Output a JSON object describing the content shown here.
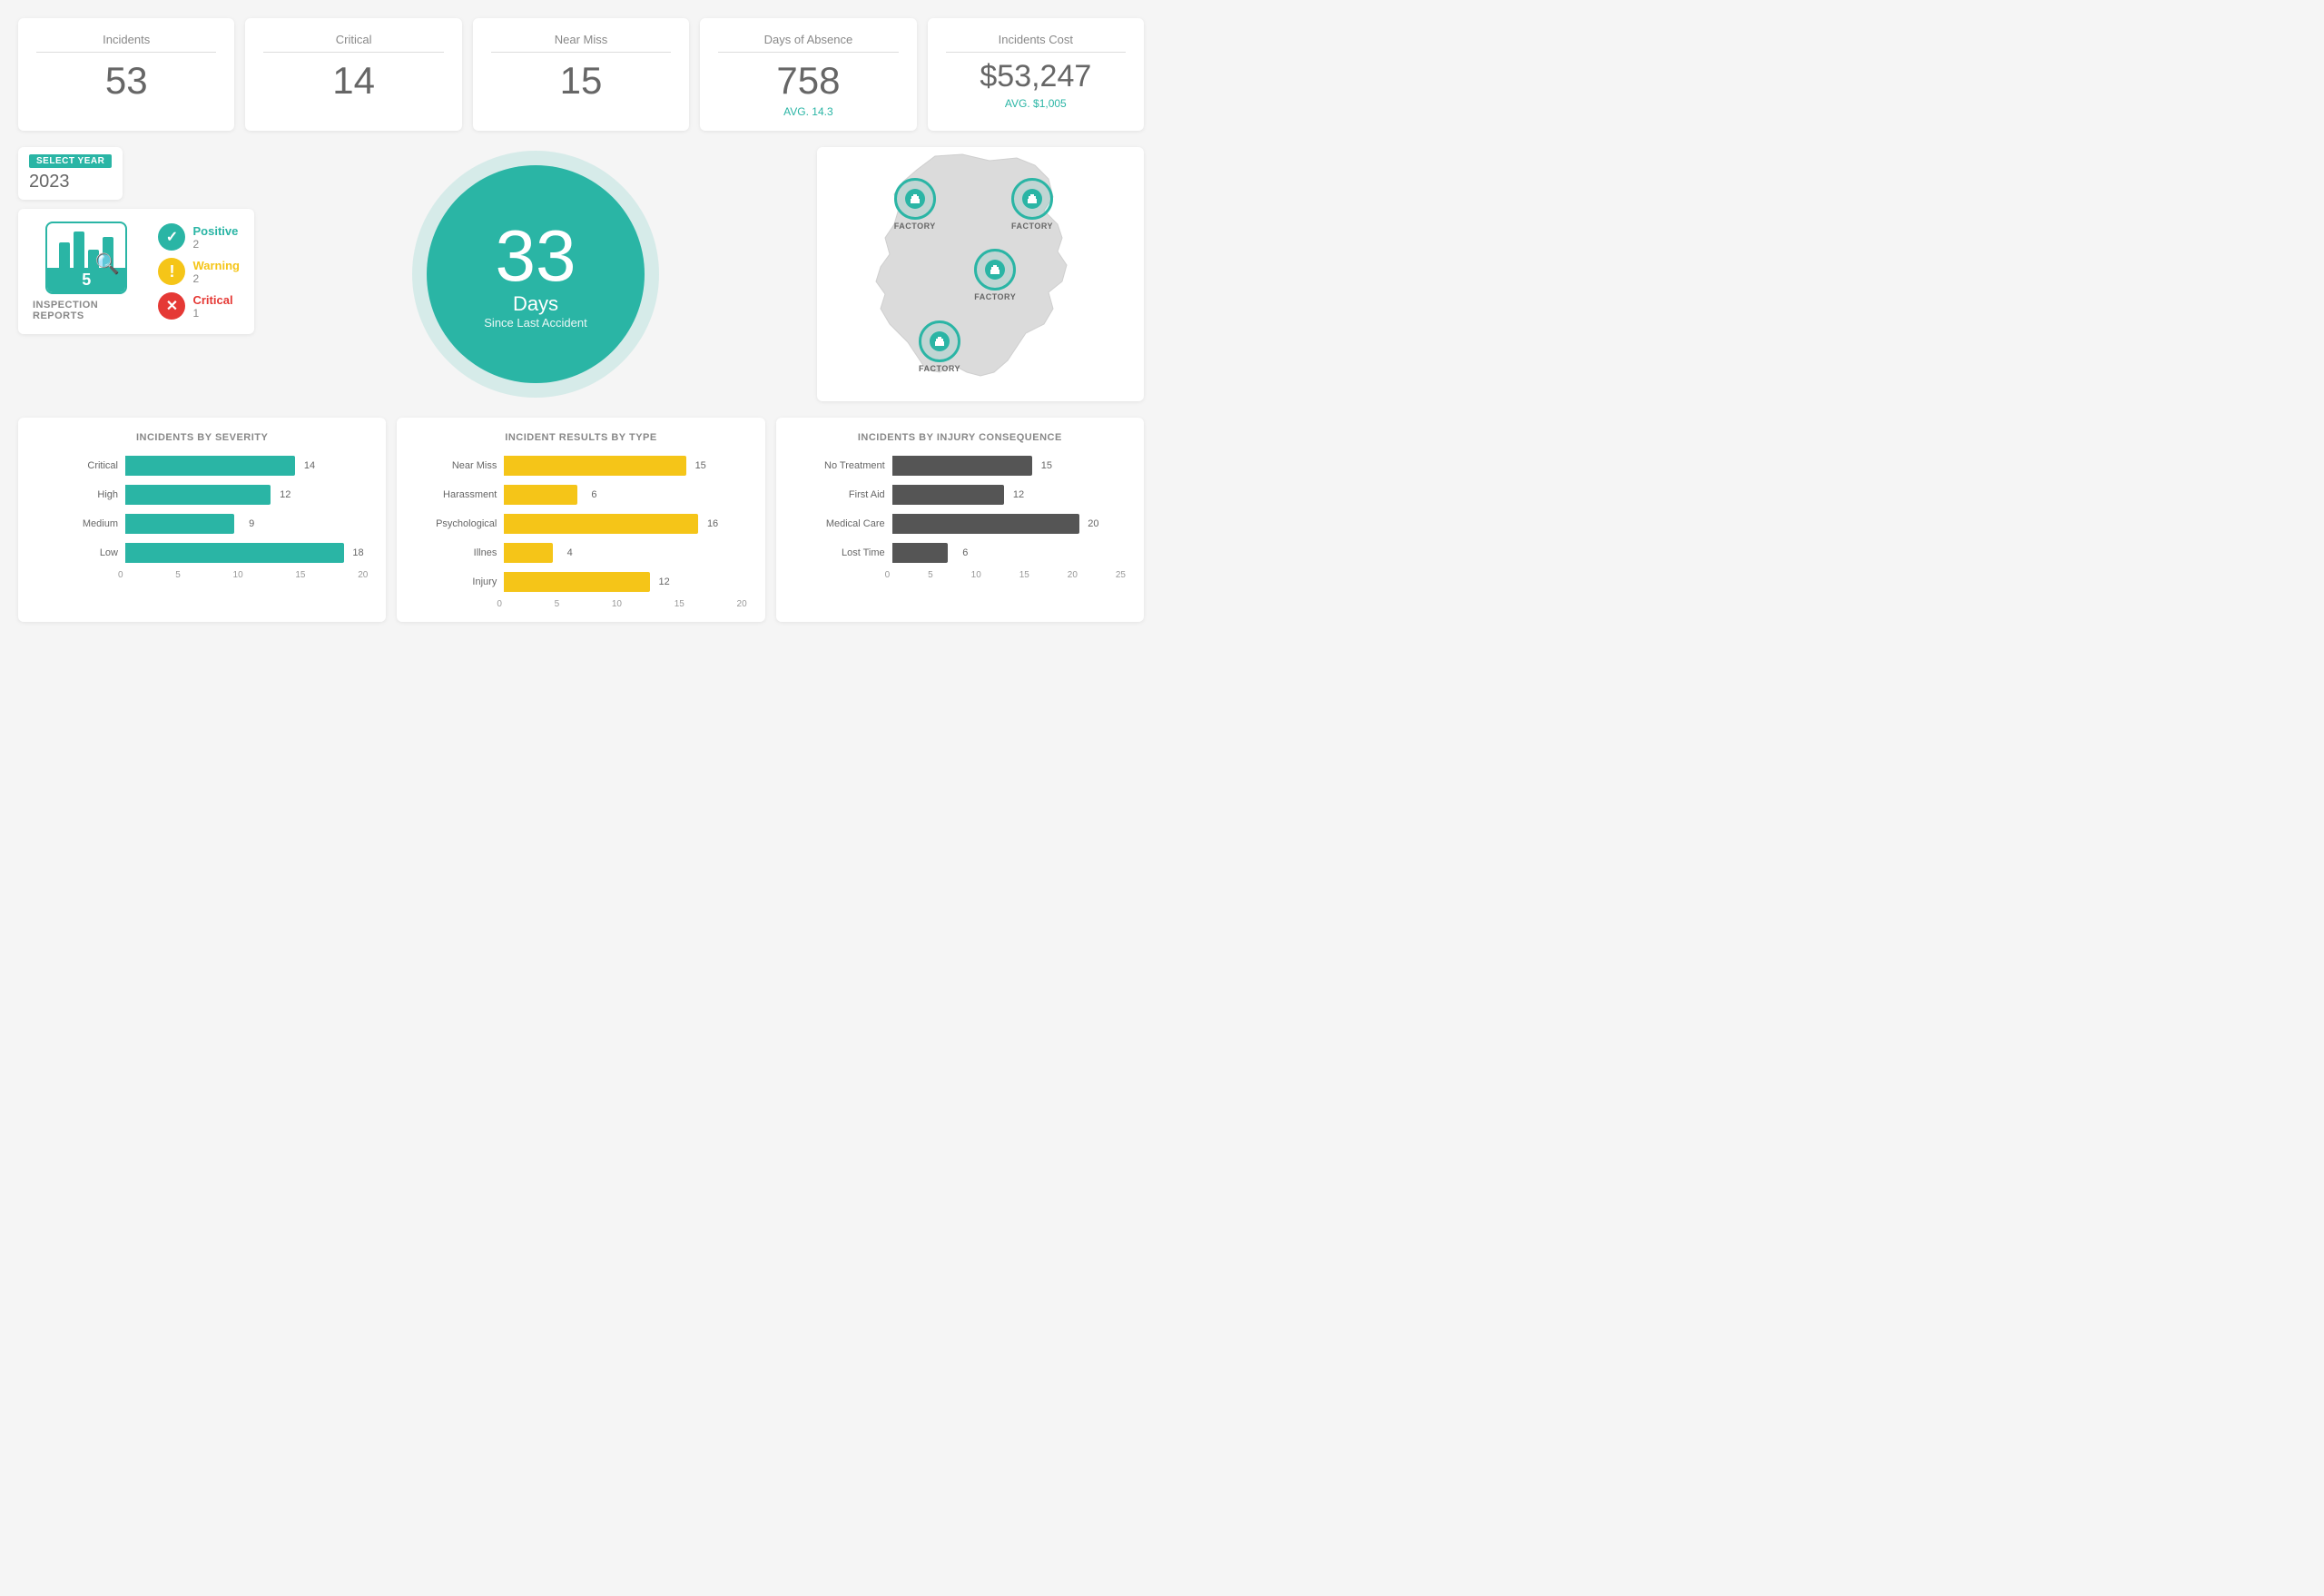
{
  "kpis": [
    {
      "label": "Incidents",
      "value": "53",
      "avg": null
    },
    {
      "label": "Critical",
      "value": "14",
      "avg": null
    },
    {
      "label": "Near Miss",
      "value": "15",
      "avg": null
    },
    {
      "label": "Days of Absence",
      "value": "758",
      "avg": "AVG. 14.3"
    },
    {
      "label": "Incidents Cost",
      "value": "$53,247",
      "avg": "AVG. $1,005"
    }
  ],
  "yearSelector": {
    "label": "SELECT YEAR",
    "value": "2023"
  },
  "inspectionReports": {
    "count": "5",
    "label": "INSPECTION REPORTS",
    "legend": [
      {
        "type": "positive",
        "label": "Positive",
        "count": "2",
        "icon": "✓"
      },
      {
        "type": "warning",
        "label": "Warning",
        "count": "2",
        "icon": "!"
      },
      {
        "type": "critical",
        "label": "Critical",
        "count": "1",
        "icon": "✕"
      }
    ]
  },
  "daysAccident": {
    "number": "33",
    "label": "Days",
    "sublabel": "Since Last Accident"
  },
  "factories": [
    {
      "label": "FACTORY",
      "top": "18%",
      "left": "28%"
    },
    {
      "label": "FACTORY",
      "top": "18%",
      "left": "62%"
    },
    {
      "label": "FACTORY",
      "top": "42%",
      "left": "50%"
    },
    {
      "label": "FACTORY",
      "top": "72%",
      "left": "38%"
    }
  ],
  "charts": {
    "severity": {
      "title": "INCIDENTS BY SEVERITY",
      "bars": [
        {
          "label": "Critical",
          "value": 14,
          "max": 20
        },
        {
          "label": "High",
          "value": 12,
          "max": 20
        },
        {
          "label": "Medium",
          "value": 9,
          "max": 20
        },
        {
          "label": "Low",
          "value": 18,
          "max": 20
        }
      ],
      "xLabels": [
        "0",
        "5",
        "10",
        "15",
        "20"
      ]
    },
    "type": {
      "title": "INCIDENT RESULTS BY TYPE",
      "bars": [
        {
          "label": "Near Miss",
          "value": 15,
          "max": 20
        },
        {
          "label": "Harassment",
          "value": 6,
          "max": 20
        },
        {
          "label": "Psychological",
          "value": 16,
          "max": 20
        },
        {
          "label": "Illnes",
          "value": 4,
          "max": 20
        },
        {
          "label": "Injury",
          "value": 12,
          "max": 20
        }
      ],
      "xLabels": [
        "0",
        "5",
        "10",
        "15",
        "20"
      ]
    },
    "consequence": {
      "title": "INCIDENTS BY INJURY CONSEQUENCE",
      "bars": [
        {
          "label": "No Treatment",
          "value": 15,
          "max": 25
        },
        {
          "label": "First Aid",
          "value": 12,
          "max": 25
        },
        {
          "label": "Medical Care",
          "value": 20,
          "max": 25
        },
        {
          "label": "Lost Time",
          "value": 6,
          "max": 25
        }
      ],
      "xLabels": [
        "0",
        "5",
        "10",
        "15",
        "20",
        "25"
      ]
    }
  }
}
